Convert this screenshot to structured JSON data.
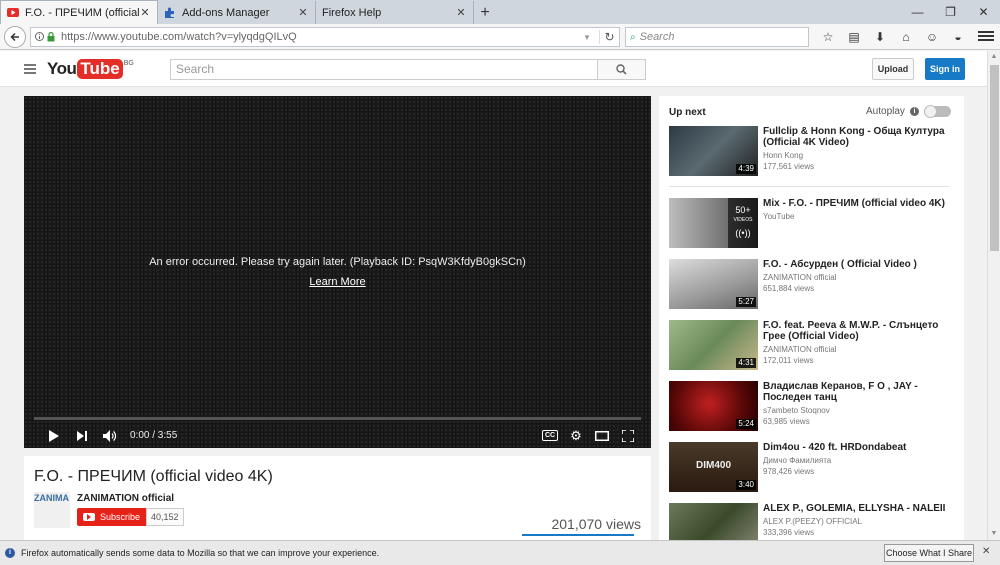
{
  "browser": {
    "tabs": [
      {
        "label": "F.O. - ПРЕЧИМ (official vi...",
        "active": true,
        "icon": "youtube-icon"
      },
      {
        "label": "Add-ons Manager",
        "active": false,
        "icon": "puzzle-icon"
      },
      {
        "label": "Firefox Help",
        "active": false,
        "icon": "none"
      }
    ],
    "new_tab": "+",
    "url": "https://www.youtube.com/watch?v=ylyqdgQILvQ",
    "search_placeholder": "Search",
    "window_buttons": {
      "minimize": "—",
      "maximize": "❐",
      "close": "✕"
    }
  },
  "youtube": {
    "logo_you": "You",
    "logo_tube": "Tube",
    "country": "BG",
    "search_placeholder": "Search",
    "upload_label": "Upload",
    "signin_label": "Sign in",
    "player": {
      "error_text": "An error occurred. Please try again later. (Playback ID: PsqW3KfdyB0gkSCn)",
      "learn_more": "Learn More",
      "time": "0:00 / 3:55",
      "cc_label": "CC"
    },
    "video": {
      "title": "F.O. - ПРЕЧИМ (official video 4K)",
      "channel_thumb_text": "ZANIMA",
      "channel": "ZANIMATION official",
      "subscribe_label": "Subscribe",
      "subscriber_count": "40,152",
      "views": "201,070 views"
    },
    "sidebar": {
      "up_next": "Up next",
      "autoplay": "Autoplay",
      "autoplay_info": "i",
      "items": [
        {
          "title": "Fullclip & Honn Kong - Обща Култура (Official 4K Video)",
          "channel": "Honn Kong",
          "views": "177,561 views",
          "duration": "4:39",
          "thumb_color": "#3d4a55"
        },
        {
          "title": "Mix - F.O. - ПРЕЧИМ (official video 4K)",
          "channel": "YouTube",
          "views": "",
          "duration": "",
          "mix_count": "50+",
          "mix_label": "VIDEOS",
          "mix_icon": "((•))",
          "thumb_color": "#8c8c8c"
        },
        {
          "title": "F.O. - Абсурден ( Official Video )",
          "channel": "ZANIMATION official",
          "views": "651,884 views",
          "duration": "5:27",
          "thumb_color": "#b8b8b8"
        },
        {
          "title": "F.O. feat. Peeva & M.W.P. - Слънцето Грее (Official Video)",
          "channel": "ZANIMATION official",
          "views": "172,011 views",
          "duration": "4:31",
          "thumb_color": "#7f9a6a"
        },
        {
          "title": "Владислав Керанов, F O , JAY - Последен танц",
          "channel": "s7ambeto Stoqnov",
          "views": "63,985 views",
          "duration": "5:24",
          "thumb_color": "#5a1010"
        },
        {
          "title": "Dim4ou - 420 ft. HRDondabeat",
          "channel": "Димчо Фамилията",
          "views": "978,426 views",
          "duration": "3:40",
          "thumb_text": "DIM400",
          "thumb_color": "#3a2a20"
        },
        {
          "title": "ALEX P., GOLEMIA, ELLYSHA - NALEII",
          "channel": "ALEX P.(PEEZY) OFFICIAL",
          "views": "333,396 views",
          "duration": "",
          "thumb_color": "#4a5a3a"
        }
      ]
    }
  },
  "notification": {
    "icon": "i",
    "text": "Firefox automatically sends some data to Mozilla so that we can improve your experience.",
    "button": "Choose What I Share",
    "close": "✕"
  }
}
